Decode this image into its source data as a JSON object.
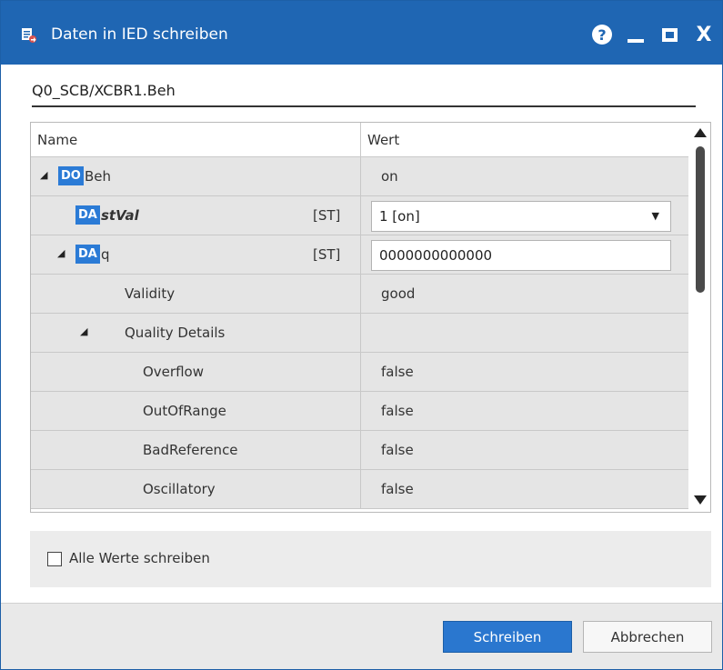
{
  "window": {
    "title": "Daten in IED schreiben",
    "icon": "write-data-icon",
    "help_icon": "?",
    "close_icon": "X"
  },
  "path": "Q0_SCB/XCBR1.Beh",
  "grid": {
    "columns": {
      "name": "Name",
      "wert": "Wert"
    },
    "rows": [
      {
        "badge": "DO",
        "name": "Beh",
        "value": "on"
      },
      {
        "badge": "DA",
        "name": "stVal",
        "fc": "[ST]",
        "select_value": "1 [on]"
      },
      {
        "badge": "DA",
        "name": "q",
        "fc": "[ST]",
        "input_value": "0000000000000"
      },
      {
        "name": "Validity",
        "value": "good"
      },
      {
        "name": "Quality Details",
        "value": ""
      },
      {
        "name": "Overflow",
        "value": "false"
      },
      {
        "name": "OutOfRange",
        "value": "false"
      },
      {
        "name": "BadReference",
        "value": "false"
      },
      {
        "name": "Oscillatory",
        "value": "false"
      }
    ]
  },
  "options": {
    "all_values_label": "Alle Werte schreiben",
    "all_values_checked": false
  },
  "footer": {
    "write_label": "Schreiben",
    "cancel_label": "Abbrechen"
  },
  "colors": {
    "titlebar": "#1f66b3",
    "badge": "#2b7bd6",
    "primary_button": "#2a77cf",
    "row_bg": "#e5e5e5"
  }
}
